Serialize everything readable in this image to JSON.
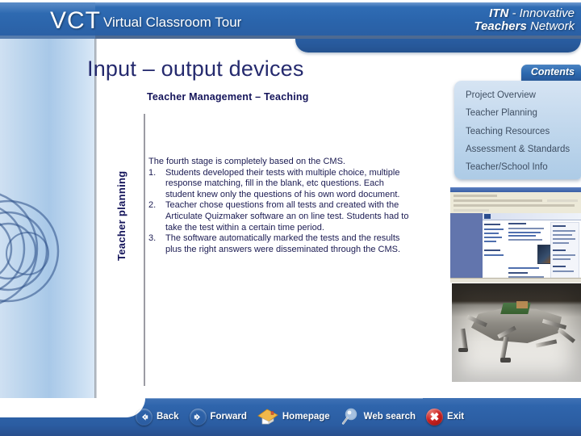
{
  "header": {
    "logo_abbrev": "VCT",
    "logo_full": "Virtual Classroom Tour",
    "brand_line1_bold": "ITN",
    "brand_line1_rest": " - Innovative",
    "brand_line2_bold": "Teachers",
    "brand_line2_rest": " Network"
  },
  "slide": {
    "title": "Input – output devices",
    "subtitle": "Teacher Management – Teaching",
    "side_label": "Teacher planning",
    "lead": "The fourth stage is completely based on the CMS.",
    "items": [
      {
        "num": "1.",
        "text": "Students developed their tests with multiple choice, multiple response matching, fill in the blank, etc questions. Each student knew only the questions of his own word document."
      },
      {
        "num": "2.",
        "text": "Teacher chose questions from all tests and created with the Articulate Quizmaker software an on line test. Students had to take the test within a certain time period."
      },
      {
        "num": "3.",
        "text": "The software automatically marked the tests and the results plus the right answers were disseminated through the CMS."
      }
    ]
  },
  "contents": {
    "tab_label": "Contents",
    "items": [
      "Project Overview",
      "Teacher Planning",
      "Teaching  Resources",
      "Assessment & Standards",
      "Teacher/School Info"
    ]
  },
  "media": {
    "browser_thumb_alt": "cms-browser-screenshot",
    "photo_thumb_alt": "robot-photograph"
  },
  "nav": {
    "items": [
      {
        "label": "Back",
        "icon": "arrow-left-icon"
      },
      {
        "label": "Forward",
        "icon": "arrow-right-icon"
      },
      {
        "label": "Homepage",
        "icon": "house-icon"
      },
      {
        "label": "Web search",
        "icon": "magnifier-icon"
      },
      {
        "label": "Exit",
        "icon": "close-x-icon"
      }
    ]
  },
  "colors": {
    "header_blue": "#2a5fa4",
    "title_navy": "#252a6e",
    "panel_blue": "#c2d8ed",
    "nav_blue": "#2f65ac",
    "exit_red": "#cc2222"
  }
}
